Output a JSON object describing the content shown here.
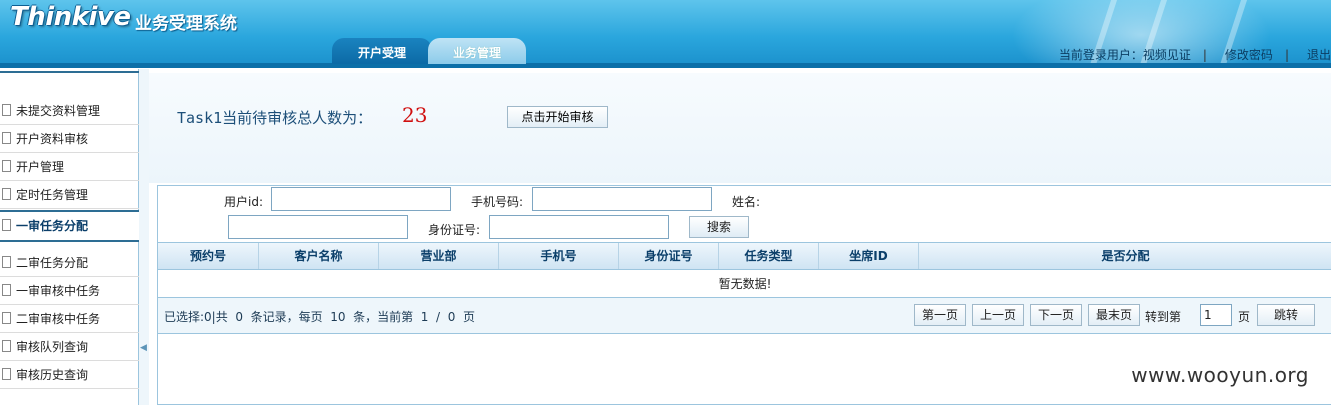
{
  "header": {
    "logo": "Thinkive",
    "system_title": "业务受理系统",
    "tabs": [
      {
        "label": "开户受理"
      },
      {
        "label": "业务管理"
      }
    ],
    "user_label": "当前登录用户：视频见证",
    "change_password": "修改密码",
    "logout": "退出",
    "separator": "|"
  },
  "sidebar": {
    "items": [
      {
        "label": "未提交资料管理"
      },
      {
        "label": "开户资料审核"
      },
      {
        "label": "开户管理"
      },
      {
        "label": "定时任务管理"
      },
      {
        "label": "一审任务分配"
      },
      {
        "label": "二审任务分配"
      },
      {
        "label": "一审审核中任务"
      },
      {
        "label": "二审审核中任务"
      },
      {
        "label": "审核队列查询"
      },
      {
        "label": "审核历史查询"
      }
    ],
    "collapse_glyph": "◀"
  },
  "main": {
    "task_label": "Task1当前待审核总人数为：",
    "task_count": "23",
    "start_button": "点击开始审核",
    "filters": {
      "user_id_label": "用户id:",
      "phone_label": "手机号码:",
      "name_label": "姓名:",
      "id_card_label": "身份证号:",
      "user_id_value": "",
      "phone_value": "",
      "name_value": "",
      "id_card_value": "",
      "search_button": "搜索"
    },
    "table": {
      "columns": [
        "预约号",
        "客户名称",
        "营业部",
        "手机号",
        "身份证号",
        "任务类型",
        "坐席ID",
        "是否分配"
      ],
      "empty_text": "暂无数据!"
    },
    "pager": {
      "info": "已选择:0|共  0  条记录，每页  10  条，当前第  1  /  0  页",
      "first": "第一页",
      "prev": "上一页",
      "next": "下一页",
      "last": "最末页",
      "goto_label": "转到第",
      "page_value": "1",
      "page_unit": "页",
      "goto_button": "跳转"
    }
  },
  "watermark": "www.wooyun.org"
}
